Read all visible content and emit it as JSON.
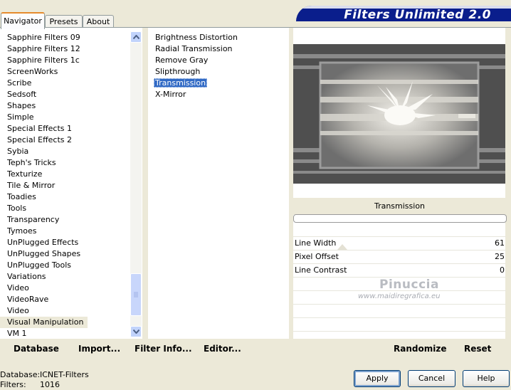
{
  "tabs": [
    "Navigator",
    "Presets",
    "About"
  ],
  "banner_title": "Filters Unlimited 2.0",
  "categories": [
    "Sapphire Filters 09",
    "Sapphire Filters 12",
    "Sapphire Filters 1c",
    "ScreenWorks",
    "Scribe",
    "Sedsoft",
    "Shapes",
    "Simple",
    "Special Effects 1",
    "Special Effects 2",
    "Sybia",
    "Teph's Tricks",
    "Texturize",
    "Tile & Mirror",
    "Toadies",
    "Tools",
    "Transparency",
    "Tymoes",
    "UnPlugged Effects",
    "UnPlugged Shapes",
    "UnPlugged Tools",
    "Variations",
    "Video",
    "VideoRave",
    "Video",
    "Visual Manipulation",
    "VM 1"
  ],
  "selected_category": "Visual Manipulation",
  "filters": [
    "Brightness Distortion",
    "Radial Transmission",
    "Remove Gray",
    "Slipthrough",
    "Transmission",
    "X-Mirror"
  ],
  "selected_filter": "Transmission",
  "preview_title": "Transmission",
  "params": [
    {
      "label": "Line Width",
      "value": "61"
    },
    {
      "label": "Pixel Offset",
      "value": "25"
    },
    {
      "label": "Line Contrast",
      "value": "0"
    }
  ],
  "watermark": {
    "name": "Pinuccia",
    "url": "www.maidiregrafica.eu"
  },
  "bottom": {
    "database": "Database",
    "import": "Import...",
    "filter_info": "Filter Info...",
    "editor": "Editor...",
    "randomize": "Randomize",
    "reset": "Reset"
  },
  "status": {
    "database_label": "Database:",
    "database_value": "ICNET-Filters",
    "filters_label": "Filters:",
    "filters_value": "1016"
  },
  "buttons": {
    "apply": "Apply",
    "cancel": "Cancel",
    "help": "Help"
  },
  "colors": {
    "selection": "#316ac5",
    "banner": "#0a1e8c",
    "face": "#ece9d8"
  }
}
